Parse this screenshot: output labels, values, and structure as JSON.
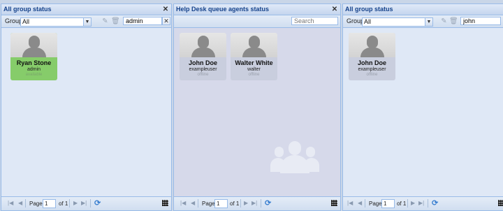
{
  "panels": [
    {
      "title": "All group status",
      "group_label": "Group:",
      "group_value": "All",
      "search_value": "admin",
      "cards": [
        {
          "name": "Ryan Stone",
          "username": "admin",
          "status": "available",
          "state": "available"
        }
      ],
      "pager": {
        "page_label": "Page",
        "page": "1",
        "of_label": "of 1"
      }
    },
    {
      "title": "Help Desk queue agents status",
      "search_placeholder": "Search",
      "cards": [
        {
          "name": "John Doe",
          "username": "exampleuser",
          "status": "offline",
          "state": "offline"
        },
        {
          "name": "Walter White",
          "username": "walter",
          "status": "offline",
          "state": "offline"
        }
      ],
      "pager": {
        "page_label": "Page",
        "page": "1",
        "of_label": "of 1"
      }
    },
    {
      "title": "All group status",
      "group_label": "Group:",
      "group_value": "All",
      "search_value": "john",
      "cards": [
        {
          "name": "John Doe",
          "username": "exampleuser",
          "status": "offline",
          "state": "offline"
        }
      ],
      "pager": {
        "page_label": "Page",
        "page": "1",
        "of_label": "of 1"
      }
    }
  ],
  "icons": {
    "close": "close-icon",
    "edit": "edit-icon",
    "delete": "trash-icon",
    "refresh": "refresh-icon",
    "grid": "grid-icon"
  },
  "colors": {
    "header_text": "#15428b",
    "available": "#86cc6a",
    "offline_card": "#c9cede"
  }
}
